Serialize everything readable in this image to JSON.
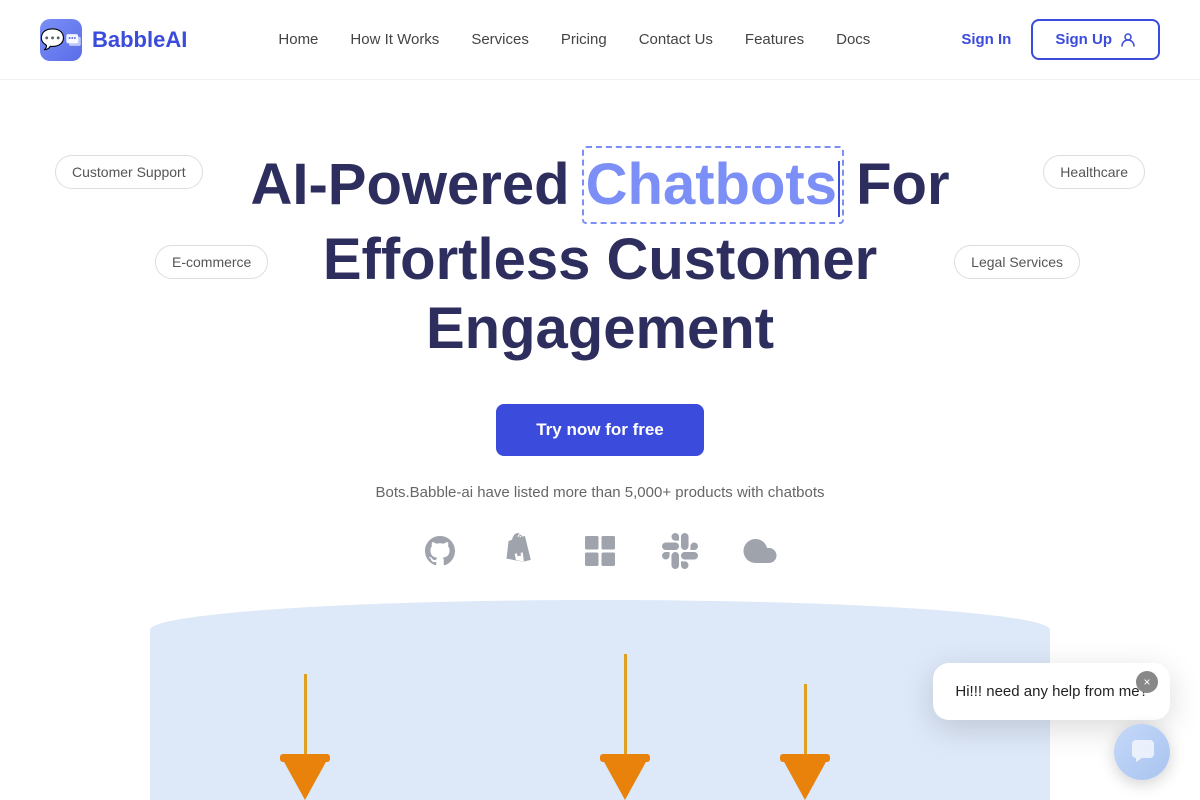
{
  "brand": {
    "name": "BabbleAI",
    "logo_alt": "BabbleAI logo"
  },
  "nav": {
    "links": [
      {
        "label": "Home",
        "href": "#"
      },
      {
        "label": "How It Works",
        "href": "#"
      },
      {
        "label": "Services",
        "href": "#"
      },
      {
        "label": "Pricing",
        "href": "#"
      },
      {
        "label": "Contact Us",
        "href": "#"
      },
      {
        "label": "Features",
        "href": "#"
      },
      {
        "label": "Docs",
        "href": "#"
      }
    ],
    "sign_in": "Sign In",
    "sign_up": "Sign Up"
  },
  "hero": {
    "headline_part1": "AI-Powered ",
    "headline_highlight": "Chatbots",
    "headline_part2": " For",
    "headline_line2": "Effortless Customer Engagement",
    "cta_label": "Try now for free",
    "stat_text": "Bots.Babble-ai have listed more than 5,000+ products with chatbots"
  },
  "floating_tags": {
    "customer_support": "Customer Support",
    "ecommerce": "E-commerce",
    "healthcare": "Healthcare",
    "legal_services": "Legal Services"
  },
  "integrations": [
    {
      "name": "GitHub",
      "icon": "github"
    },
    {
      "name": "Shopify",
      "icon": "shopify"
    },
    {
      "name": "Windows",
      "icon": "windows"
    },
    {
      "name": "Slack",
      "icon": "slack"
    },
    {
      "name": "Cloud",
      "icon": "cloud"
    }
  ],
  "chat_popup": {
    "message": "Hi!!! need any help from me?",
    "close_label": "×"
  }
}
